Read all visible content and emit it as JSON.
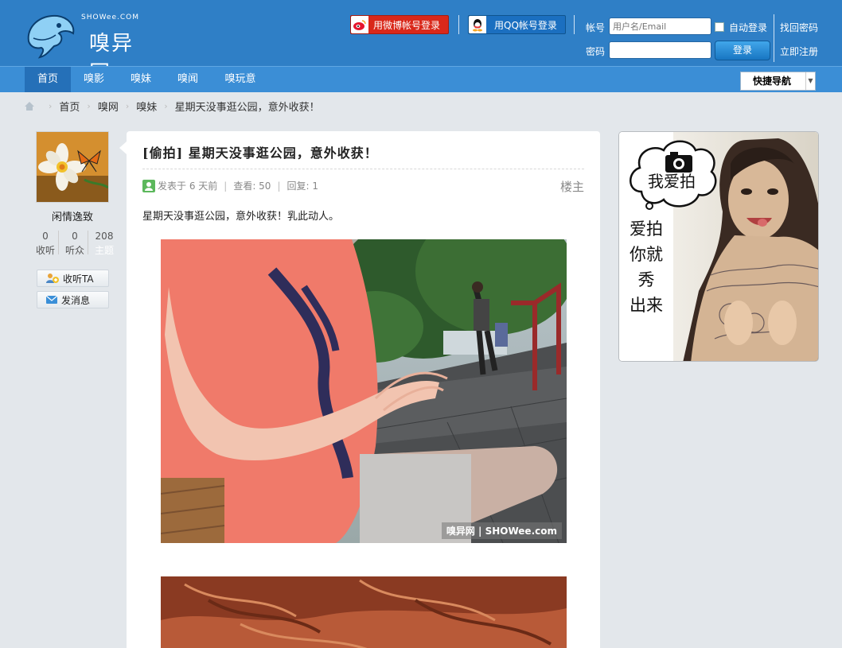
{
  "site": {
    "logo_cn": "嗅异网",
    "logo_en": "SHOWee.COM"
  },
  "login": {
    "weibo_label": "用微博帐号登录",
    "qq_label": "用QQ帐号登录",
    "account_label": "帐号",
    "account_placeholder": "用户名/Email",
    "password_label": "密码",
    "auto_login_label": "自动登录",
    "login_button": "登录",
    "forgot_password": "找回密码",
    "register": "立即注册"
  },
  "nav": {
    "items": [
      {
        "label": "首页",
        "active": true
      },
      {
        "label": "嗅影"
      },
      {
        "label": "嗅妹"
      },
      {
        "label": "嗅闻"
      },
      {
        "label": "嗅玩意"
      }
    ],
    "quick_nav": "快捷导航"
  },
  "breadcrumb": [
    "首页",
    "嗅网",
    "嗅妹",
    "星期天没事逛公园，意外收获！"
  ],
  "author": {
    "name": "闲情逸致",
    "stats": [
      {
        "value": "0",
        "label": "收听"
      },
      {
        "value": "0",
        "label": "听众"
      },
      {
        "value": "208",
        "label": "主题"
      }
    ],
    "follow_button": "收听TA",
    "message_button": "发消息"
  },
  "post": {
    "title": "[偷拍] 星期天没事逛公园，意外收获！",
    "posted": "发表于 6 天前",
    "views": "查看: 50",
    "replies": "回复: 1",
    "floor": "楼主",
    "body": "星期天没事逛公园，意外收获！乳此动人。",
    "watermark": "嗅异网 | SHOWee.com"
  },
  "ad": {
    "cloud_text": "我爱拍",
    "lines": [
      "爱拍",
      "你就",
      "秀",
      "出来"
    ]
  },
  "colors": {
    "header_bg": "#2f7fc6",
    "nav_bg": "#3b8ed6",
    "page_bg": "#e3e7eb"
  }
}
